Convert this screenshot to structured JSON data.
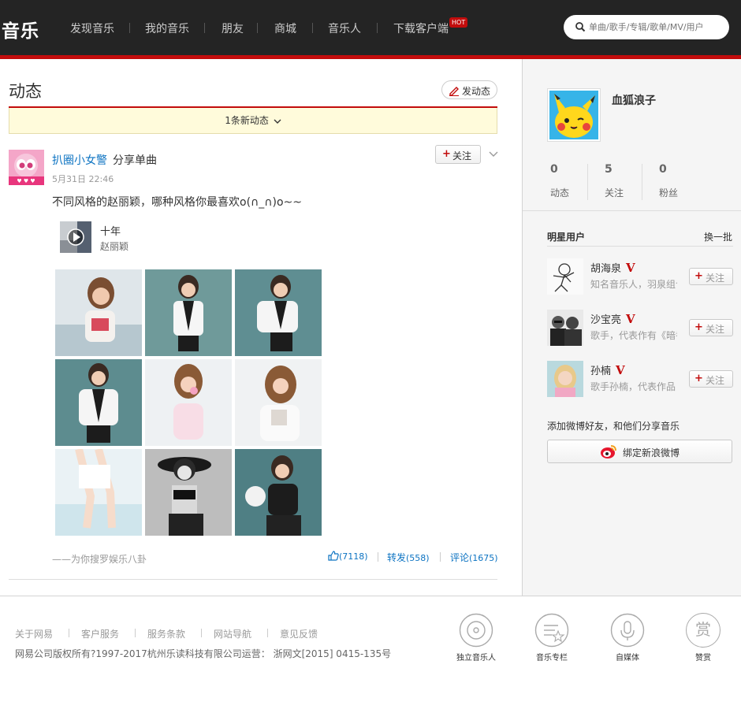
{
  "header": {
    "logo": "音乐",
    "nav": [
      "发现音乐",
      "我的音乐",
      "朋友",
      "商城",
      "音乐人",
      "下载客户端"
    ],
    "hot_badge": "HOT",
    "search_placeholder": "单曲/歌手/专辑/歌单/MV/用户"
  },
  "feed": {
    "title": "动态",
    "post_button": "发动态",
    "new_posts": "1条新动态",
    "post": {
      "user": "扒圈小女警",
      "action": "分享单曲",
      "time": "5月31日 22:46",
      "follow": "关注",
      "text": "不同风格的赵丽颖，哪种风格你最喜欢o(∩_∩)o~~",
      "song_title": "十年",
      "song_artist": "赵丽颖",
      "photo_count": 9,
      "source": "——为你搜罗娱乐八卦",
      "likes": "(7118)",
      "share_label": "转发",
      "share_count": "(558)",
      "comment_label": "评论",
      "comment_count": "(1675)"
    }
  },
  "profile": {
    "name": "血狐浪子",
    "stats": [
      {
        "count": "0",
        "label": "动态"
      },
      {
        "count": "5",
        "label": "关注"
      },
      {
        "count": "0",
        "label": "粉丝"
      }
    ]
  },
  "stars": {
    "title": "明星用户",
    "refresh": "换一批",
    "items": [
      {
        "name": "胡海泉",
        "desc": "知名音乐人，羽泉组合成员",
        "follow": "关注"
      },
      {
        "name": "沙宝亮",
        "desc": "歌手，代表作有《暗香》",
        "follow": "关注"
      },
      {
        "name": "孙楠",
        "desc": "歌手孙楠，代表作品",
        "follow": "关注"
      }
    ],
    "verified_mark": "V"
  },
  "weibo": {
    "text": "添加微博好友，和他们分享音乐",
    "button": "绑定新浪微博"
  },
  "footer": {
    "links": [
      "关于网易",
      "客户服务",
      "服务条款",
      "网站导航",
      "意见反馈"
    ],
    "copyright": "网易公司版权所有?1997-2017杭州乐读科技有限公司运营：  浙网文[2015] 0415-135号",
    "icons": [
      "独立音乐人",
      "音乐专栏",
      "自媒体",
      "赞赏"
    ],
    "reward_glyph": "赏"
  },
  "colors": {
    "accent": "#c20c0c",
    "link": "#0c73c2",
    "topbar": "#242424"
  }
}
